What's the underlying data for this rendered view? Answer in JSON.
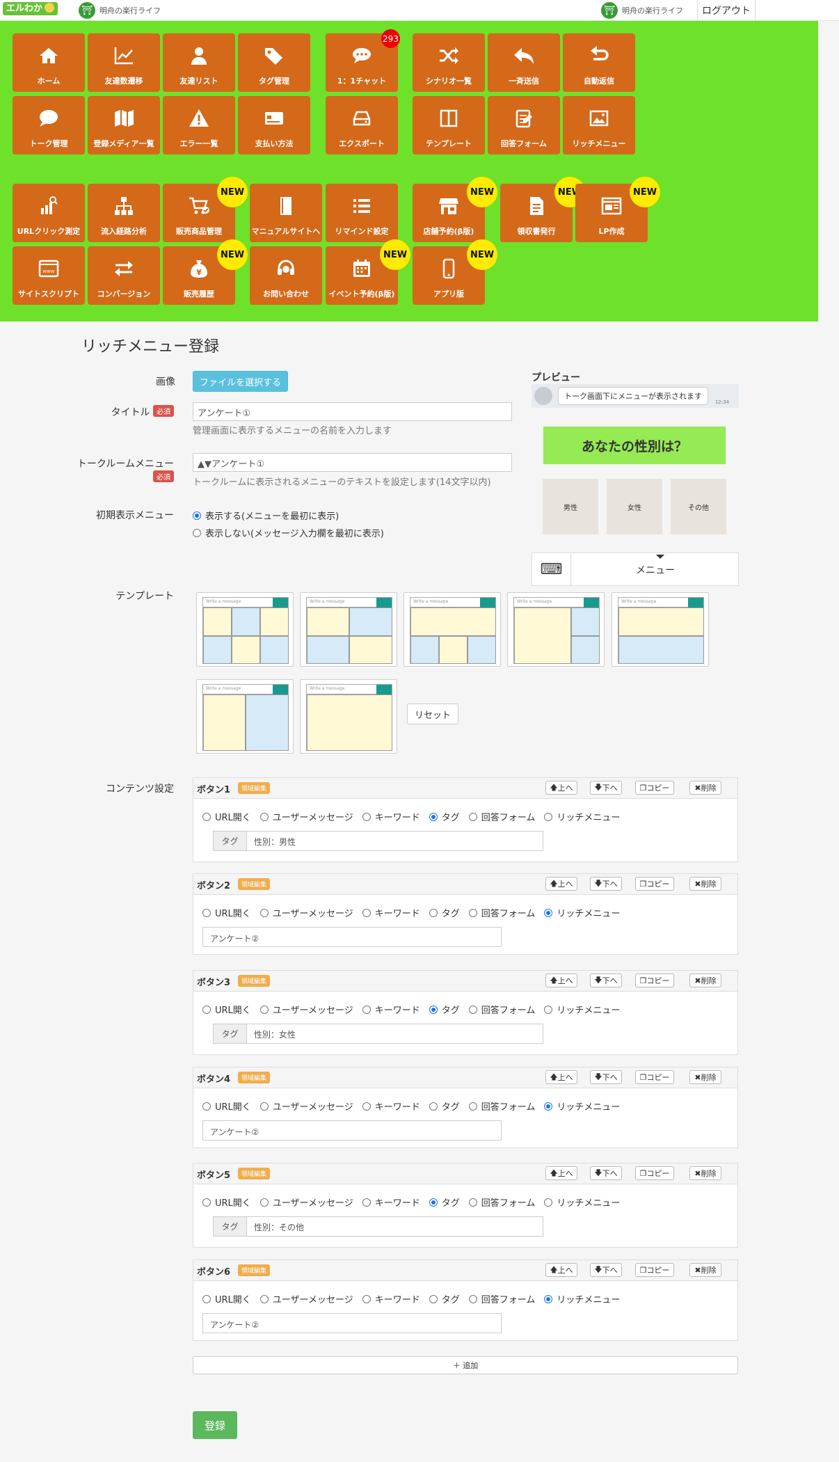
{
  "header": {
    "logo": "エルわか",
    "account_left": "明舟の楽行ライフ",
    "account_right": "明舟の楽行ライフ",
    "logout": "ログアウト"
  },
  "nav": {
    "tiles": [
      {
        "label": "ホーム",
        "icon": "home-icon"
      },
      {
        "label": "友達数遷移",
        "icon": "line-chart-icon"
      },
      {
        "label": "友達リスト",
        "icon": "user-icon"
      },
      {
        "label": "タグ管理",
        "icon": "tags-icon"
      },
      {
        "label": "1：1チャット",
        "icon": "chat-icon",
        "badge": "293"
      },
      {
        "label": "シナリオ一覧",
        "icon": "shuffle-icon"
      },
      {
        "label": "一斉送信",
        "icon": "reply-icon"
      },
      {
        "label": "自動返信",
        "icon": "return-icon"
      },
      {
        "label": "トーク管理",
        "icon": "speech-bubble-icon"
      },
      {
        "label": "登録メディア一覧",
        "icon": "map-icon"
      },
      {
        "label": "エラー一覧",
        "icon": "warning-icon"
      },
      {
        "label": "支払い方法",
        "icon": "card-icon"
      },
      {
        "label": "エクスポート",
        "icon": "drive-icon"
      },
      {
        "label": "テンプレート",
        "icon": "columns-icon"
      },
      {
        "label": "回答フォーム",
        "icon": "form-edit-icon"
      },
      {
        "label": "リッチメニュー",
        "icon": "picture-icon"
      },
      {
        "label": "URLクリック測定",
        "icon": "bar-search-icon"
      },
      {
        "label": "流入経路分析",
        "icon": "sitemap-icon"
      },
      {
        "label": "販売商品管理",
        "icon": "cart-check-icon",
        "new": "NEW"
      },
      {
        "label": "マニュアルサイトへ",
        "icon": "book-icon"
      },
      {
        "label": "リマインド設定",
        "icon": "list-icon"
      },
      {
        "label": "店舗予約(β版)",
        "icon": "store-icon",
        "new": "NEW"
      },
      {
        "label": "領収書発行",
        "icon": "receipt-icon",
        "new": "NEW"
      },
      {
        "label": "LP作成",
        "icon": "lp-icon",
        "new": "NEW"
      },
      {
        "label": "サイトスクリプト",
        "icon": "www-icon"
      },
      {
        "label": "コンバージョン",
        "icon": "exchange-icon"
      },
      {
        "label": "販売履歴",
        "icon": "money-bag-icon",
        "new": "NEW"
      },
      {
        "label": "お問い合わせ",
        "icon": "headset-icon"
      },
      {
        "label": "イベント予約(β版)",
        "icon": "calendar-icon",
        "new": "NEW"
      },
      {
        "label": "アプリ版",
        "icon": "mobile-icon",
        "new": "NEW"
      }
    ]
  },
  "page": {
    "title": "リッチメニュー登録"
  },
  "form": {
    "image_label": "画像",
    "file_button": "ファイルを選択する",
    "title_label": "タイトル",
    "required": "必須",
    "title_value": "アンケート①",
    "title_help": "管理画面に表示するメニューの名前を入力します",
    "talkroom_label": "トークルームメニュー",
    "talkroom_value": "▲▼アンケート①",
    "talkroom_help": "トークルームに表示されるメニューのテキストを設定します(14文字以内)",
    "initial_label": "初期表示メニュー",
    "initial_opt1": "表示する(メニューを最初に表示)",
    "initial_opt2": "表示しない(メッセージ入力欄を最初に表示)",
    "template_label": "テンプレート",
    "template_placeholder": "Write a message",
    "reset": "リセット",
    "contents_label": "コンテンツ設定",
    "add": "＋ 追加",
    "submit": "登録"
  },
  "preview": {
    "label": "プレビュー",
    "bubble": "トーク画面下にメニューが表示されます",
    "time": "12:34",
    "question": "あなたの性別は？",
    "choices": [
      "男性",
      "女性",
      "その他"
    ],
    "menu": "メニュー"
  },
  "buttons_common": {
    "area_edit": "領域編集",
    "up": "上へ",
    "down": "下へ",
    "copy": "コピー",
    "delete": "削除",
    "options": [
      "URL開く",
      "ユーザーメッセージ",
      "キーワード",
      "タグ",
      "回答フォーム",
      "リッチメニュー"
    ],
    "tag_addon": "タグ"
  },
  "buttons": [
    {
      "title": "ボタン1",
      "selected": "タグ",
      "value": "性別：男性"
    },
    {
      "title": "ボタン2",
      "selected": "リッチメニュー",
      "value": "アンケート②"
    },
    {
      "title": "ボタン3",
      "selected": "タグ",
      "value": "性別：女性"
    },
    {
      "title": "ボタン4",
      "selected": "リッチメニュー",
      "value": "アンケート②"
    },
    {
      "title": "ボタン5",
      "selected": "タグ",
      "value": "性別：その他"
    },
    {
      "title": "ボタン6",
      "selected": "リッチメニュー",
      "value": "アンケート②"
    }
  ],
  "colors": {
    "nav_bg": "#6ee12a",
    "tile": "#d4691a",
    "new_badge": "#ffeb00",
    "preview_question": "#96ea54",
    "teal": "#1a9a8e"
  }
}
